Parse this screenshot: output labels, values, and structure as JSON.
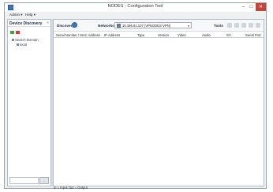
{
  "window": {
    "title": "NODES - Configuration Tool"
  },
  "window_controls": {
    "minimize": "–",
    "maximize": "□",
    "close": "✕"
  },
  "menu": {
    "items": [
      "Admin ▾",
      "Help ▾"
    ]
  },
  "sidebar": {
    "title": "Device Discovery",
    "tree": {
      "root": "Search Domain",
      "child": "local"
    },
    "button_label": "..."
  },
  "toolbar": {
    "discovery_label": "Discovery",
    "networks_label": "Networks",
    "network_value": "10.196.51.107 (VPNODES-VPN)",
    "tools_label": "Tools"
  },
  "table": {
    "columns": [
      "Serial Number / MAC Address",
      "IP Address",
      "Type",
      "Version",
      "Video",
      "Audio",
      "I/O",
      "Serial Port"
    ],
    "rows": []
  },
  "status": {
    "legend": "In = Input  Out = Output"
  }
}
